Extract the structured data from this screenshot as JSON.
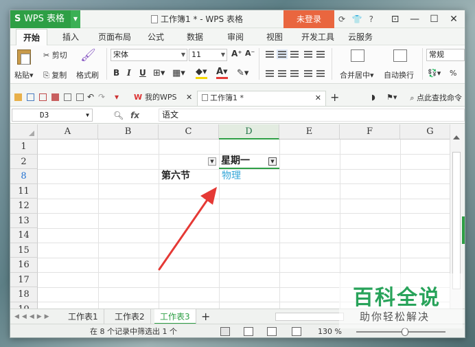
{
  "app": {
    "name": "WPS 表格",
    "document_title": "工作簿1 * - WPS 表格",
    "login_label": "未登录",
    "title_icons": [
      "⟳",
      "👕",
      "?"
    ],
    "window_controls": [
      "⊡",
      "—",
      "☐",
      "✕"
    ]
  },
  "menu": {
    "tabs": [
      "开始",
      "插入",
      "页面布局",
      "公式",
      "数据",
      "审阅",
      "视图",
      "开发工具",
      "云服务"
    ]
  },
  "ribbon": {
    "cut_label": "剪切",
    "paste_label": "粘贴",
    "copy_label": "复制",
    "format_painter_label": "格式刷",
    "font_name": "宋体",
    "font_size": "11",
    "bold": "B",
    "italic": "I",
    "underline": "U",
    "grow_font": "A⁺",
    "shrink_font": "A⁻",
    "merge_label": "合并居中",
    "wrap_label": "自动换行",
    "number_format": "常规",
    "percent": "%"
  },
  "doc_tabs": {
    "mywps": "我的WPS",
    "workbook": "工作簿1 *",
    "search_label": "点此查找命令"
  },
  "formula_bar": {
    "name_box": "D3",
    "fx": "fx",
    "content": "语文"
  },
  "grid": {
    "columns": [
      "A",
      "B",
      "C",
      "D",
      "E",
      "F",
      "G"
    ],
    "rows": [
      "1",
      "2",
      "8",
      "11",
      "12",
      "13",
      "14",
      "15",
      "16",
      "17",
      "18",
      "19"
    ],
    "cells": {
      "D2": "星期一",
      "C8": "第六节",
      "D8": "物理"
    }
  },
  "sheets": {
    "tabs": [
      "工作表1",
      "工作表2",
      "工作表3"
    ],
    "active_index": 2,
    "add": "+"
  },
  "status": {
    "filter_text": "在 8 个记录中筛选出 1 个",
    "zoom": "130 %"
  },
  "watermark": {
    "title": "百科全说",
    "subtitle": "助你轻松解决"
  },
  "colors": {
    "brand_green": "#2e9f45",
    "login_orange": "#e9663f",
    "arrow_red": "#e53935",
    "link_blue": "#36a7d8"
  }
}
